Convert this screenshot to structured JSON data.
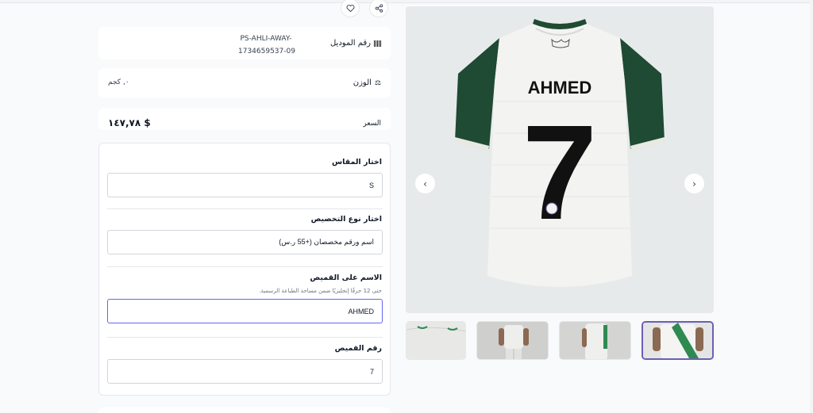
{
  "product": {
    "model_label": "رقم الموديل",
    "model_value": "PS-AHLI-AWAY-\n1734659537-09",
    "weight_label": "الوزن",
    "weight_value": "٠, كجم",
    "price_label": "السعر",
    "price_value": "$ ١٤٧,٧٨"
  },
  "form": {
    "size_label": "اختار المقاس",
    "size_value": "S",
    "custom_type_label": "اختار نوع التخصيص",
    "custom_type_value": "اسم ورقم مخصصان (+55 ر.س)",
    "name_label": "الاسم على القميص",
    "name_hint": "حتى 12 حرفًا إنجليزيًا ضمن مساحة الطباعة الرسمية.",
    "name_value": "AHMED",
    "number_label": "رقم القميص",
    "number_value": "7"
  },
  "jersey": {
    "name": "AHMED",
    "number": "7",
    "body_color": "#f3f3f1",
    "sleeve_color": "#1f4a33",
    "accent_color": "#6d5eb5"
  },
  "gallery": {
    "prev_icon": "chevron-left-icon",
    "next_icon": "chevron-right-icon",
    "thumbnail_count": 4,
    "active_thumbnail": 4
  },
  "actions": {
    "share_icon": "share-icon",
    "favorite_icon": "heart-icon"
  }
}
